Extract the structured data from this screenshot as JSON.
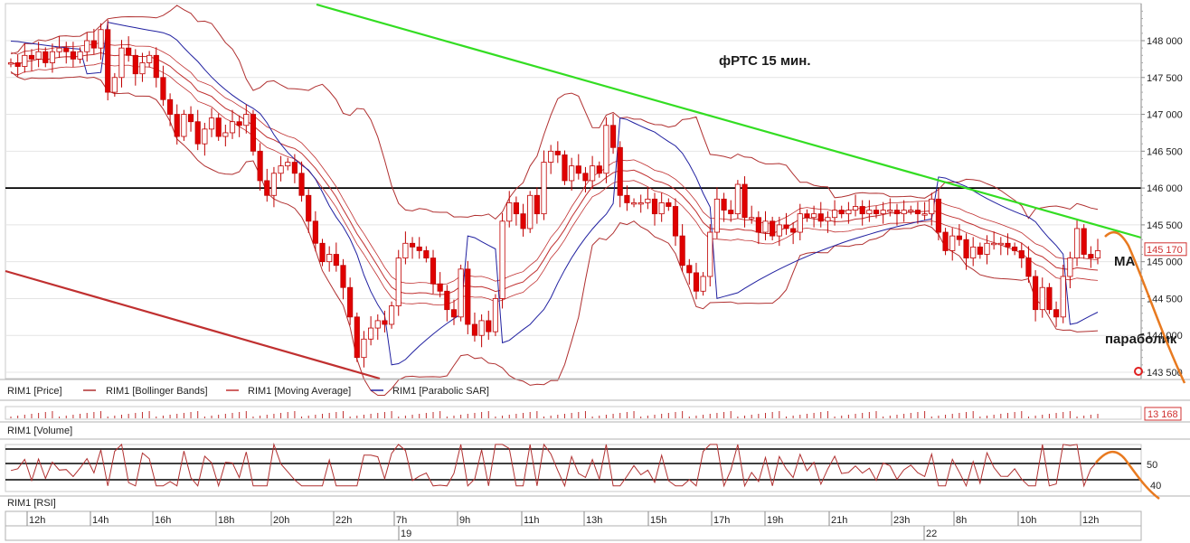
{
  "annotations": {
    "title": "фРТС   15 мин.",
    "ma_label": "МА",
    "parabolic_label": "параболик"
  },
  "legend": {
    "price": "RIM1 [Price]",
    "bollinger": "RIM1 [Bollinger Bands]",
    "moving_average": "RIM1 [Moving Average]",
    "parabolic_sar": "RIM1 [Parabolic SAR]"
  },
  "volume_panel": {
    "label": "RIM1 [Volume]",
    "last_value": "13 168"
  },
  "rsi_panel": {
    "label": "RIM1 [RSI]",
    "levels": [
      "50",
      "40"
    ]
  },
  "price_panel": {
    "last_price_tag": "145 170"
  },
  "time_axis": {
    "hours": [
      "12h",
      "14h",
      "16h",
      "18h",
      "20h",
      "22h",
      "7h",
      "9h",
      "11h",
      "13h",
      "15h",
      "17h",
      "19h",
      "21h",
      "23h",
      "8h",
      "10h",
      "12h"
    ],
    "dates": [
      "19",
      "22"
    ]
  },
  "colors": {
    "up_candle": "#ffffff",
    "down_candle": "#e00000",
    "bollinger": "#b03030",
    "moving_average": "#c03030",
    "parabolic_sar": "#2020a0",
    "trend_green": "#33dd22",
    "trend_red": "#c03030",
    "forecast": "#e87a20"
  },
  "chart_data": [
    {
      "type": "candlestick",
      "y_ticks": [
        "148 000",
        "147 500",
        "147 000",
        "146 500",
        "146 000",
        "145 500",
        "145 000",
        "144 500",
        "144 000",
        "143 500"
      ],
      "ylim": [
        143400,
        148500
      ],
      "horizontal_line": 146000,
      "last_price": 145170,
      "series": [
        {
          "name": "RIM1 [Price]",
          "close": [
            147700,
            147650,
            147800,
            147750,
            147850,
            147700,
            147850,
            147900,
            147850,
            147750,
            147850,
            148000,
            147900,
            148150,
            147300,
            147500,
            147900,
            147800,
            147550,
            147700,
            147800,
            147500,
            147200,
            147000,
            146700,
            147000,
            146900,
            146600,
            146800,
            146950,
            146700,
            146750,
            146900,
            146850,
            147000,
            146500,
            146100,
            145900,
            146200,
            146300,
            146350,
            146200,
            145900,
            145550,
            145250,
            145000,
            145100,
            144950,
            144650,
            144250,
            143700,
            143950,
            144100,
            144200,
            144150,
            144400,
            145050,
            145250,
            145200,
            145150,
            145050,
            144700,
            144600,
            144350,
            144250,
            144900,
            144150,
            144000,
            144200,
            144050,
            144500,
            145550,
            145800,
            145650,
            145450,
            145900,
            145650,
            146350,
            146500,
            146450,
            146100,
            146300,
            146200,
            146100,
            146300,
            146200,
            146850,
            146550,
            145900,
            145800,
            145800,
            145800,
            145850,
            145650,
            145800,
            145750,
            145350,
            144950,
            144850,
            144600,
            144800,
            145400,
            145850,
            145700,
            145650,
            146050,
            145600,
            145600,
            145400,
            145550,
            145350,
            145500,
            145450,
            145400,
            145650,
            145600,
            145650,
            145550,
            145600,
            145700,
            145650,
            145700,
            145750,
            145650,
            145700,
            145650,
            145700,
            145700,
            145650,
            145700,
            145700,
            145650,
            145650,
            145850,
            145400,
            145150,
            145350,
            145300,
            145050,
            145200,
            145100,
            145250,
            145250,
            145250,
            145200,
            145150,
            145050,
            144800,
            144350,
            144650,
            144350,
            144250,
            144800,
            145050,
            145450,
            145100,
            145050,
            145150
          ]
        }
      ],
      "overlays": [
        "RIM1 [Bollinger Bands]",
        "RIM1 [Moving Average]",
        "RIM1 [Parabolic SAR]"
      ]
    },
    {
      "type": "bar",
      "series": [
        {
          "name": "RIM1 [Volume]",
          "last": 13168
        }
      ]
    },
    {
      "type": "line",
      "series": [
        {
          "name": "RIM1 [RSI]"
        }
      ],
      "levels": [
        50,
        40
      ]
    }
  ]
}
